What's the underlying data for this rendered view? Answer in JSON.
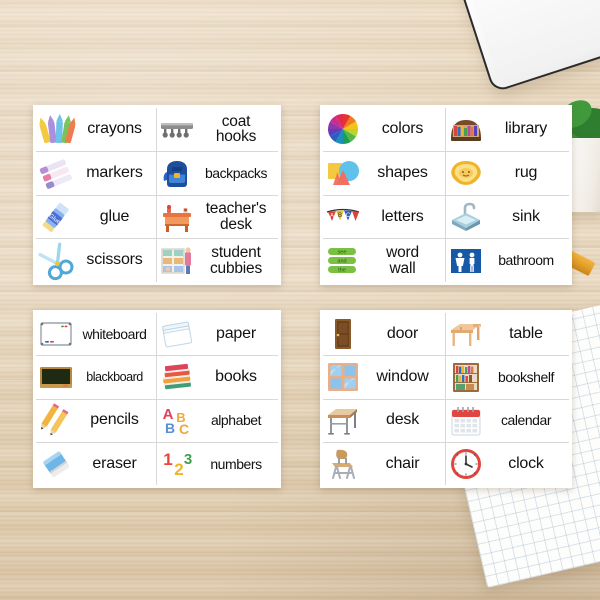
{
  "scene": {
    "description": "Classroom vocabulary label cards on a wooden desk",
    "background_color": "#e6d5bb",
    "props": [
      {
        "name": "keyboard",
        "label": "white keyboard"
      },
      {
        "name": "plant",
        "label": "green potted plant"
      },
      {
        "name": "pencil",
        "label": "yellow pencil"
      },
      {
        "name": "notebook",
        "label": "grid notebook"
      }
    ]
  },
  "cards": [
    {
      "id": "supplies",
      "rows": [
        [
          {
            "icon": "crayons-icon",
            "label": "crayons",
            "size": "normal"
          },
          {
            "icon": "coat-hooks-icon",
            "label": "coat\nhooks",
            "size": "normal"
          }
        ],
        [
          {
            "icon": "markers-icon",
            "label": "markers",
            "size": "normal"
          },
          {
            "icon": "backpack-icon",
            "label": "backpacks",
            "size": "small"
          }
        ],
        [
          {
            "icon": "glue-icon",
            "label": "glue",
            "size": "normal"
          },
          {
            "icon": "teachers-desk-icon",
            "label": "teacher's\ndesk",
            "size": "normal"
          }
        ],
        [
          {
            "icon": "scissors-icon",
            "label": "scissors",
            "size": "normal"
          },
          {
            "icon": "student-cubbies-icon",
            "label": "student\ncubbies",
            "size": "normal"
          }
        ]
      ]
    },
    {
      "id": "areas",
      "rows": [
        [
          {
            "icon": "color-wheel-icon",
            "label": "colors",
            "size": "normal"
          },
          {
            "icon": "library-icon",
            "label": "library",
            "size": "normal"
          }
        ],
        [
          {
            "icon": "shapes-icon",
            "label": "shapes",
            "size": "normal"
          },
          {
            "icon": "rug-icon",
            "label": "rug",
            "size": "normal"
          }
        ],
        [
          {
            "icon": "letters-banner-icon",
            "label": "letters",
            "size": "normal"
          },
          {
            "icon": "sink-icon",
            "label": "sink",
            "size": "normal"
          }
        ],
        [
          {
            "icon": "word-wall-icon",
            "label": "word\nwall",
            "size": "normal"
          },
          {
            "icon": "bathroom-icon",
            "label": "bathroom",
            "size": "small"
          }
        ]
      ]
    },
    {
      "id": "writing",
      "rows": [
        [
          {
            "icon": "whiteboard-icon",
            "label": "whiteboard",
            "size": "small"
          },
          {
            "icon": "paper-icon",
            "label": "paper",
            "size": "normal"
          }
        ],
        [
          {
            "icon": "blackboard-icon",
            "label": "blackboard",
            "size": "xsmall"
          },
          {
            "icon": "books-icon",
            "label": "books",
            "size": "normal"
          }
        ],
        [
          {
            "icon": "pencils-icon",
            "label": "pencils",
            "size": "normal"
          },
          {
            "icon": "alphabet-icon",
            "label": "alphabet",
            "size": "small"
          }
        ],
        [
          {
            "icon": "eraser-icon",
            "label": "eraser",
            "size": "normal"
          },
          {
            "icon": "numbers-icon",
            "label": "numbers",
            "size": "small"
          }
        ]
      ]
    },
    {
      "id": "furniture",
      "rows": [
        [
          {
            "icon": "door-icon",
            "label": "door",
            "size": "normal"
          },
          {
            "icon": "table-icon",
            "label": "table",
            "size": "normal"
          }
        ],
        [
          {
            "icon": "window-icon",
            "label": "window",
            "size": "normal"
          },
          {
            "icon": "bookshelf-icon",
            "label": "bookshelf",
            "size": "small"
          }
        ],
        [
          {
            "icon": "desk-icon",
            "label": "desk",
            "size": "normal"
          },
          {
            "icon": "calendar-icon",
            "label": "calendar",
            "size": "small"
          }
        ],
        [
          {
            "icon": "chair-icon",
            "label": "chair",
            "size": "normal"
          },
          {
            "icon": "clock-icon",
            "label": "clock",
            "size": "normal"
          }
        ]
      ]
    }
  ],
  "word_wall_words": [
    "see",
    "and",
    "the"
  ],
  "letters_banner": [
    "A",
    "B",
    "C"
  ],
  "alphabet_letters": [
    "A",
    "B",
    "C"
  ],
  "numbers_digits": [
    "1",
    "2",
    "3"
  ],
  "colors": {
    "card_background": "#ffffff",
    "cell_border": "#d8d8d8",
    "text": "#121212",
    "desk": "#e6d5bb",
    "notebook_edge": "#2a7fc4"
  }
}
